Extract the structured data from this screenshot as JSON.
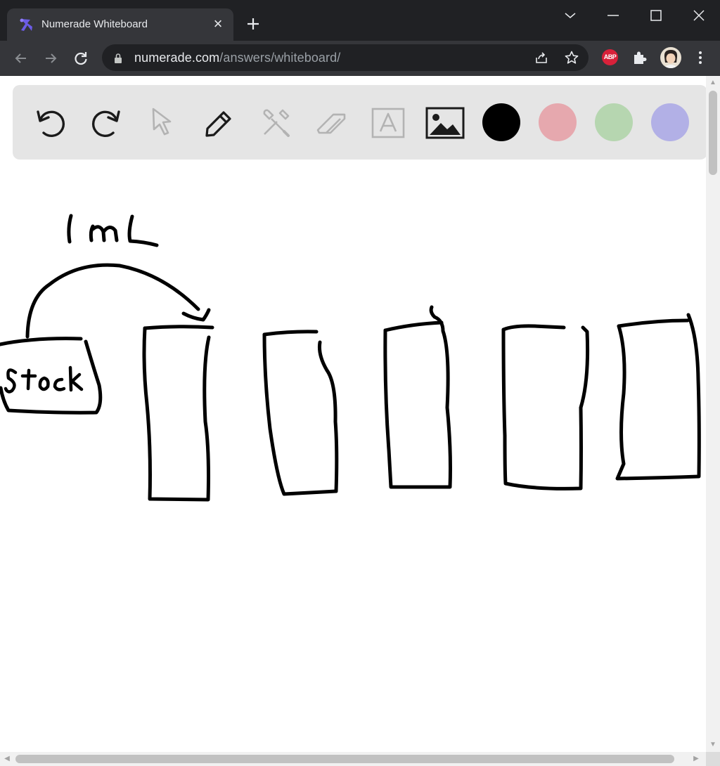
{
  "browser": {
    "tab_title": "Numerade Whiteboard",
    "url_host": "numerade.com",
    "url_path": "/answers/whiteboard/",
    "extension_badge": "ABP"
  },
  "whiteboard": {
    "tools": [
      {
        "name": "undo-icon",
        "enabled": true
      },
      {
        "name": "redo-icon",
        "enabled": true
      },
      {
        "name": "select-cursor-icon",
        "enabled": false
      },
      {
        "name": "pen-icon",
        "enabled": true
      },
      {
        "name": "tools-icon",
        "enabled": false
      },
      {
        "name": "eraser-icon",
        "enabled": false
      },
      {
        "name": "text-icon",
        "enabled": false
      },
      {
        "name": "image-icon",
        "enabled": true
      }
    ],
    "colors": [
      "#000000",
      "#e6a8ae",
      "#b6d6b0",
      "#b2b0e6"
    ],
    "handwriting": {
      "volume_label": "1mL",
      "stock_label": "Stock"
    }
  },
  "theme": {
    "titlebar": "#202124",
    "toolbar": "#35363a",
    "whiteboard_toolbar": "#e5e5e5"
  }
}
